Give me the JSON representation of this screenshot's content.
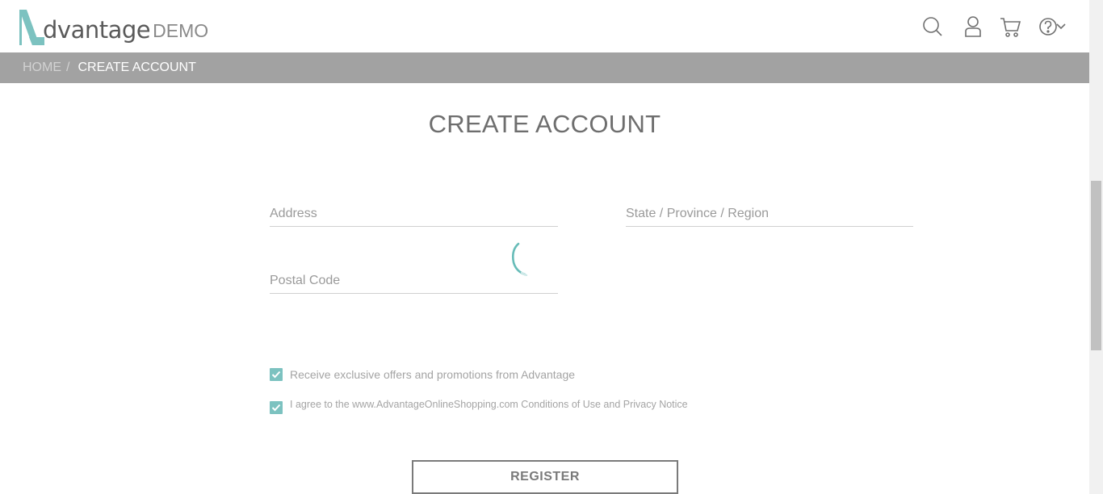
{
  "brand": {
    "logo_word": "dvantage",
    "logo_demo": "DEMO",
    "accent_color": "#7cc2c0"
  },
  "header": {
    "icons": [
      "search-icon",
      "user-icon",
      "cart-icon",
      "help-icon",
      "chevron-down-icon"
    ]
  },
  "breadcrumb": {
    "home": "HOME",
    "separator": "/",
    "current": "CREATE ACCOUNT"
  },
  "page": {
    "title": "CREATE ACCOUNT"
  },
  "form": {
    "address": {
      "placeholder": "Address",
      "value": ""
    },
    "state": {
      "placeholder": "State / Province / Region",
      "value": ""
    },
    "postal_code": {
      "placeholder": "Postal Code",
      "value": ""
    },
    "offers_checkbox": {
      "label": "Receive exclusive offers and promotions from Advantage",
      "checked": true
    },
    "terms_checkbox": {
      "label": "I agree to the www.AdvantageOnlineShopping.com Conditions of Use and Privacy Notice",
      "checked": true
    },
    "register_label": "REGISTER"
  }
}
